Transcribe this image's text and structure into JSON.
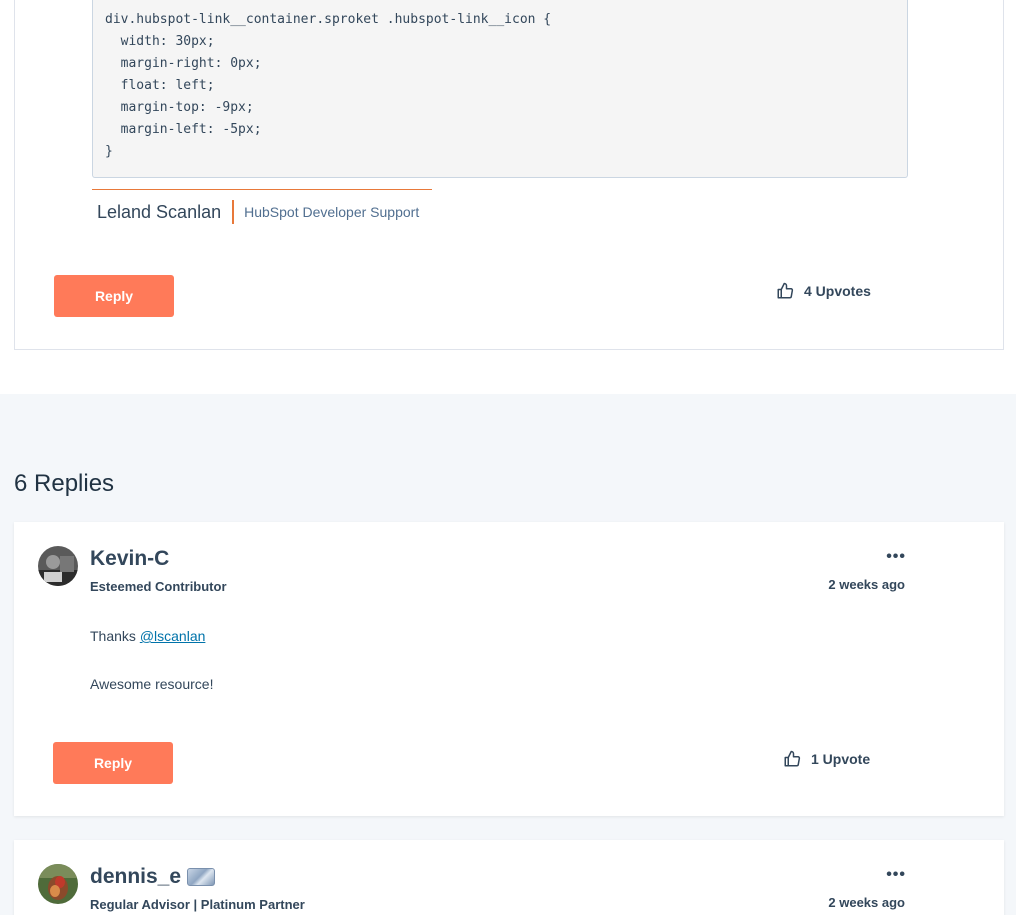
{
  "original_post": {
    "code_lines": [
      "div.hubspot-link__container.sproket .hubspot-link__icon {",
      "  width: 30px;",
      "  margin-right: 0px;",
      "  float: left;",
      "  margin-top: -9px;",
      "  margin-left: -5px;",
      "}"
    ],
    "signature_name": "Leland Scanlan",
    "signature_role": "HubSpot Developer Support",
    "reply_label": "Reply",
    "upvotes": "4 Upvotes"
  },
  "replies_heading": "6 Replies",
  "replies": [
    {
      "author": "Kevin-C",
      "rank": "Esteemed Contributor",
      "time": "2 weeks ago",
      "more": "•••",
      "body_prefix": "Thanks ",
      "mention": "@lscanlan",
      "body_second": "Awesome resource!",
      "reply_label": "Reply",
      "upvotes": "1 Upvote"
    },
    {
      "author": "dennis_e",
      "rank": "Regular Advisor | Platinum Partner",
      "time": "2 weeks ago",
      "more": "•••"
    }
  ],
  "colors": {
    "accent": "#ff7a59",
    "signature_accent": "#e8793a",
    "text": "#33475b",
    "link": "#0073aa"
  }
}
